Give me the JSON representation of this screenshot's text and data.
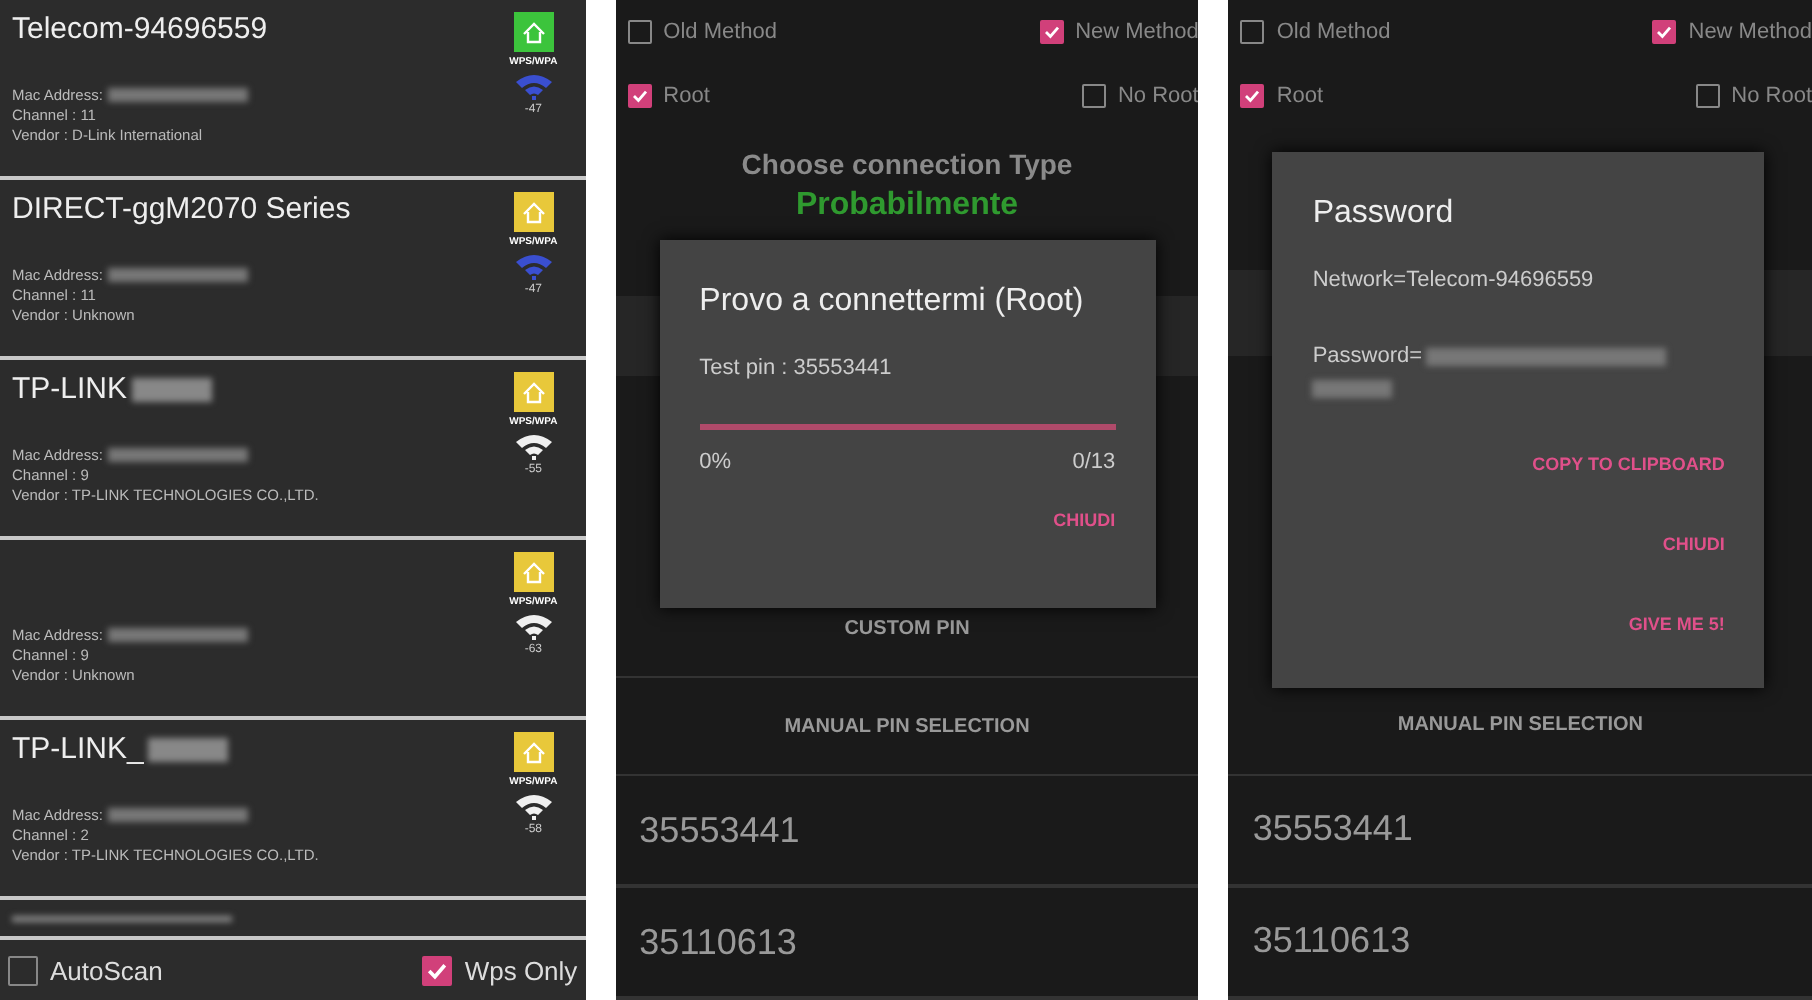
{
  "scanner": {
    "networks": [
      {
        "ssid": "Telecom-94696559",
        "mac": "Mac Address:",
        "channel": "Channel : 11",
        "vendor": "Vendor : D-Link International",
        "badge": {
          "label": "WPS/WPA",
          "color": "#3cc43c"
        },
        "wifi": {
          "color": "#3a4fd0"
        },
        "rssi": "-47"
      },
      {
        "ssid": "DIRECT-ggM2070 Series",
        "mac": "Mac Address:",
        "channel": "Channel : 11",
        "vendor": "Vendor : Unknown",
        "badge": {
          "label": "WPS/WPA",
          "color": "#e8c83a"
        },
        "wifi": {
          "color": "#3a4fd0"
        },
        "rssi": "-47"
      },
      {
        "ssid": "TP-LINK",
        "mac": "Mac Address:",
        "channel": "Channel : 9",
        "vendor": "Vendor : TP-LINK TECHNOLOGIES CO.,LTD.",
        "badge": {
          "label": "WPS/WPA",
          "color": "#e8c83a"
        },
        "wifi": {
          "color": "#f0f0f0"
        },
        "rssi": "-55"
      },
      {
        "mac": "Mac Address:",
        "channel": "Channel : 9",
        "vendor": "Vendor : Unknown",
        "badge": {
          "label": "WPS/WPA",
          "color": "#e8c83a"
        },
        "wifi": {
          "color": "#f0f0f0"
        },
        "rssi": "-63"
      },
      {
        "ssid": "TP-LINK_",
        "mac": "Mac Address:",
        "channel": "Channel : 2",
        "vendor": "Vendor : TP-LINK TECHNOLOGIES CO.,LTD.",
        "badge": {
          "label": "WPS/WPA",
          "color": "#e8c83a"
        },
        "wifi": {
          "color": "#f0f0f0"
        },
        "rssi": "-58"
      }
    ],
    "options": [
      {
        "label": "AutoScan",
        "checked": false
      },
      {
        "label": "Wps Only",
        "checked": true
      }
    ]
  },
  "connect_screen": {
    "options": [
      {
        "label": "Old Method",
        "checked": false
      },
      {
        "label": "New Method",
        "checked": true
      },
      {
        "label": "Root",
        "checked": true
      },
      {
        "label": "No Root",
        "checked": false
      }
    ],
    "heading": "Choose connection Type",
    "status": "Probabilmente",
    "custom_pin": "CUSTOM PIN",
    "manual": "MANUAL PIN SELECTION",
    "pins": [
      "35553441",
      "35110613"
    ],
    "dialog": {
      "title": "Provo a connettermi (Root)",
      "test_pin": "Test pin : 35553441",
      "level": 0,
      "percent": "0%",
      "count": "0/13",
      "button": "CHIUDI"
    }
  },
  "password_screen": {
    "options": [
      {
        "label": "Old Method",
        "checked": false
      },
      {
        "label": "New Method",
        "checked": true
      },
      {
        "label": "Root",
        "checked": true
      },
      {
        "label": "No Root",
        "checked": false
      }
    ],
    "manual": "MANUAL PIN SELECTION",
    "pins": [
      "35553441",
      "35110613"
    ],
    "dialog": {
      "title": "Password",
      "network": "Network=Telecom-94696559",
      "password_label": "Password=",
      "buttons": [
        "COPY TO CLIPBOARD",
        "CHIUDI",
        "GIVE ME 5!"
      ]
    }
  }
}
